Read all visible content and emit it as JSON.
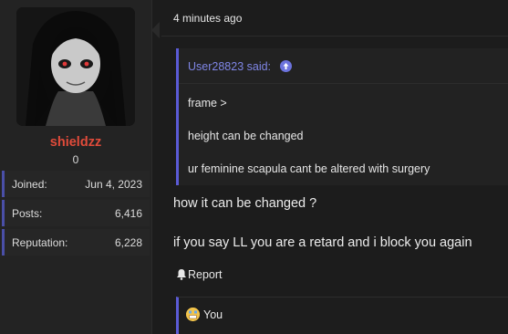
{
  "user": {
    "username": "shieldzz",
    "title": "0",
    "stats": [
      {
        "label": "Joined:",
        "value": "Jun 4, 2023"
      },
      {
        "label": "Posts:",
        "value": "6,416"
      },
      {
        "label": "Reputation:",
        "value": "6,228"
      }
    ]
  },
  "post": {
    "timestamp": "4 minutes ago",
    "quote": {
      "author": "User28823 said:",
      "lines": [
        "frame >",
        "height can be changed",
        "ur feminine scapula cant be altered with surgery"
      ]
    },
    "body": [
      "how it can be changed ?",
      "if you say LL you are a retard and i block you again"
    ],
    "report_label": "Report",
    "reactions": {
      "label": "You"
    }
  },
  "colors": {
    "username": "#e04b3a",
    "accent": "#5b5bd6",
    "quote_author": "#7f86e6"
  }
}
